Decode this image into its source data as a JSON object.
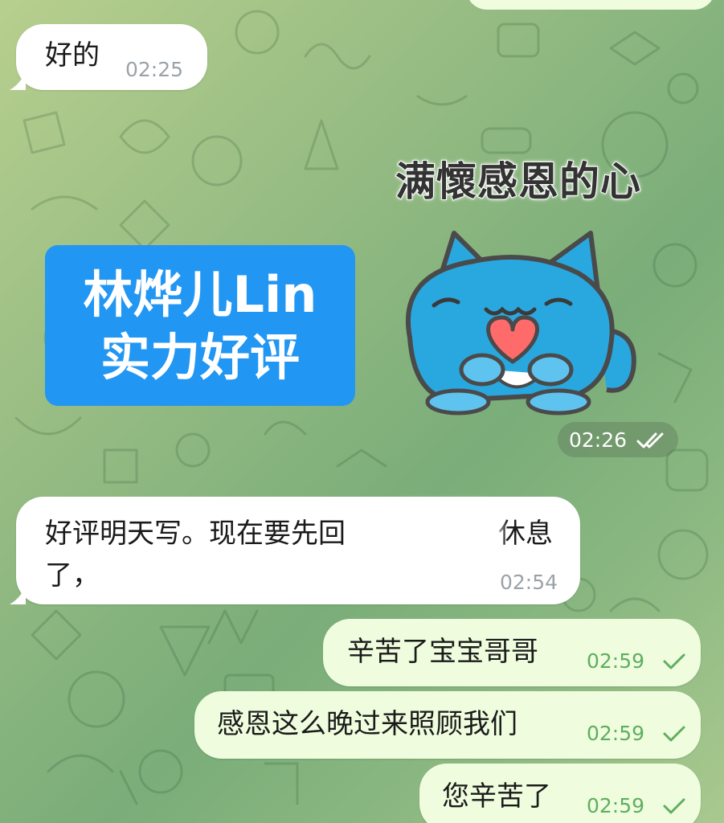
{
  "colors": {
    "incoming_bubble": "#ffffff",
    "outgoing_bubble": "#effdde",
    "promo_card": "#2196f3",
    "check_green": "#5fae5f"
  },
  "messages": [
    {
      "direction": "incoming",
      "text": "好的",
      "time": "02:25"
    },
    {
      "direction": "incoming",
      "type": "image",
      "lines": [
        "林烨儿Lin",
        "实力好评"
      ]
    },
    {
      "direction": "outgoing",
      "type": "sticker",
      "caption": "满懷感恩的心",
      "time": "02:26",
      "status_icon": "double-check-icon"
    },
    {
      "direction": "incoming",
      "text_line1": "好评明天写。现在要先回",
      "text_line1_end": "休息",
      "text_line2": "了，",
      "time": "02:54"
    },
    {
      "direction": "outgoing",
      "text": "辛苦了宝宝哥哥",
      "time": "02:59",
      "status_icon": "check-icon"
    },
    {
      "direction": "outgoing",
      "text": "感恩这么晚过来照顾我们",
      "time": "02:59",
      "status_icon": "check-icon"
    },
    {
      "direction": "outgoing",
      "text": "您辛苦了",
      "time": "02:59",
      "status_icon": "check-icon"
    }
  ]
}
